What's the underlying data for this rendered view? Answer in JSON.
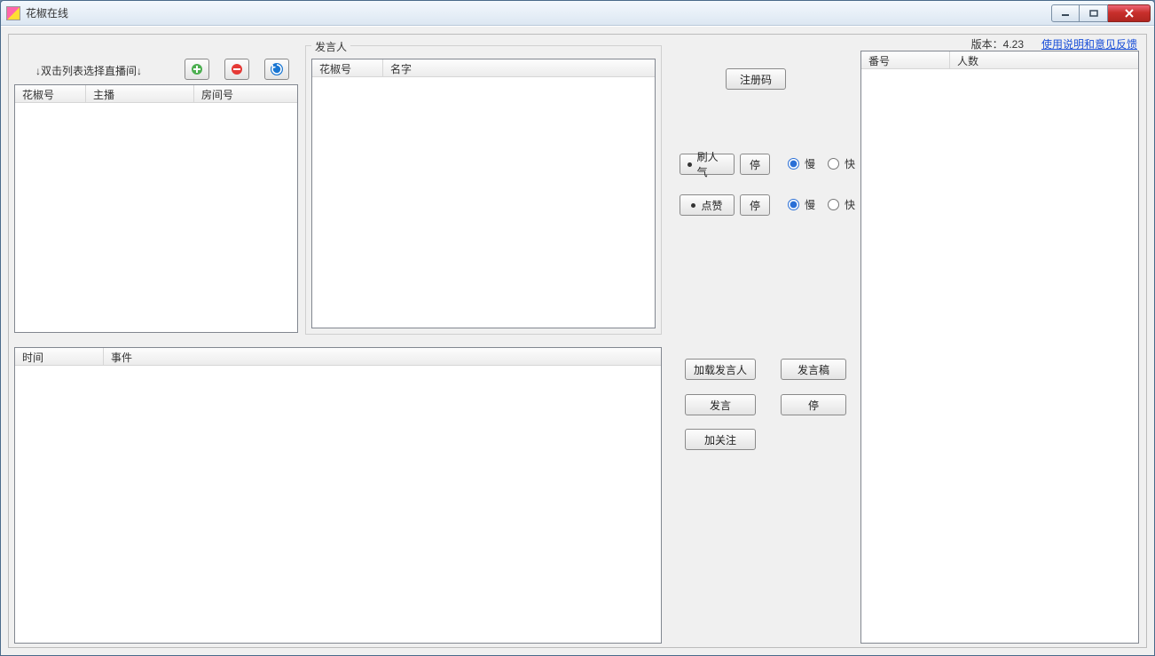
{
  "window": {
    "title": "花椒在线"
  },
  "header": {
    "version_label": "版本：4.23",
    "help_link": "使用说明和意见反馈"
  },
  "left_panel": {
    "instruction": "↓双击列表选择直播间↓",
    "broadcast_list": {
      "columns": {
        "huajiao_id": "花椒号",
        "anchor": "主播",
        "room_id": "房间号"
      }
    }
  },
  "speaker_group": {
    "title": "发言人",
    "columns": {
      "huajiao_id": "花椒号",
      "name": "名字"
    }
  },
  "event_list": {
    "columns": {
      "time": "时间",
      "event": "事件"
    }
  },
  "controls": {
    "register_code": "注册码",
    "popularity_btn": "刷人气",
    "popularity_stop": "停",
    "like_btn": "点赞",
    "like_stop": "停",
    "speed_slow": "慢",
    "speed_fast": "快",
    "load_speakers": "加载发言人",
    "script_btn": "发言稿",
    "speak_btn": "发言",
    "speak_stop": "停",
    "follow_btn": "加关注"
  },
  "right_list": {
    "columns": {
      "id": "番号",
      "count": "人数"
    }
  },
  "icons": {
    "add": "add-icon",
    "remove": "remove-icon",
    "refresh": "refresh-icon"
  }
}
